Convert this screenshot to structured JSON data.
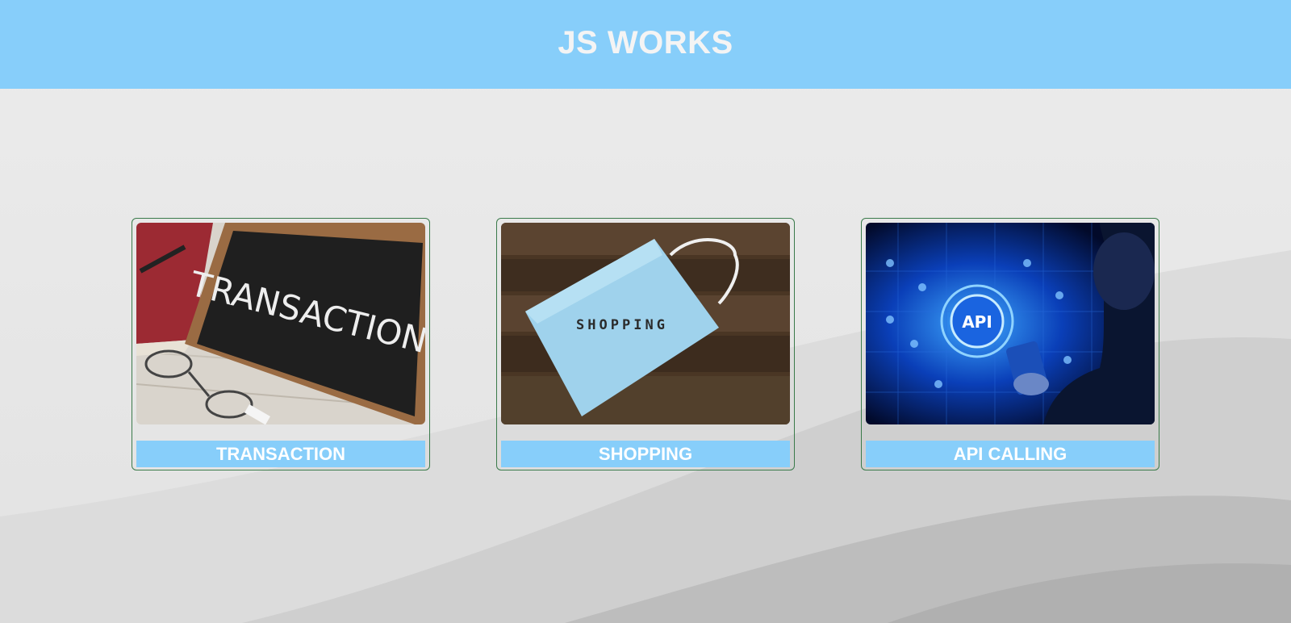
{
  "header": {
    "title": "JS WORKS"
  },
  "cards": [
    {
      "label": "TRANSACTION",
      "image_text": "TRANSACTION"
    },
    {
      "label": "SHOPPING",
      "image_text": "SHOPPING"
    },
    {
      "label": "API CALLING",
      "image_text": "API"
    }
  ],
  "colors": {
    "header_bg": "#87cefa",
    "label_bg": "#87cefa",
    "card_border": "#3a7a4a",
    "page_bg": "#e6e6e6"
  }
}
